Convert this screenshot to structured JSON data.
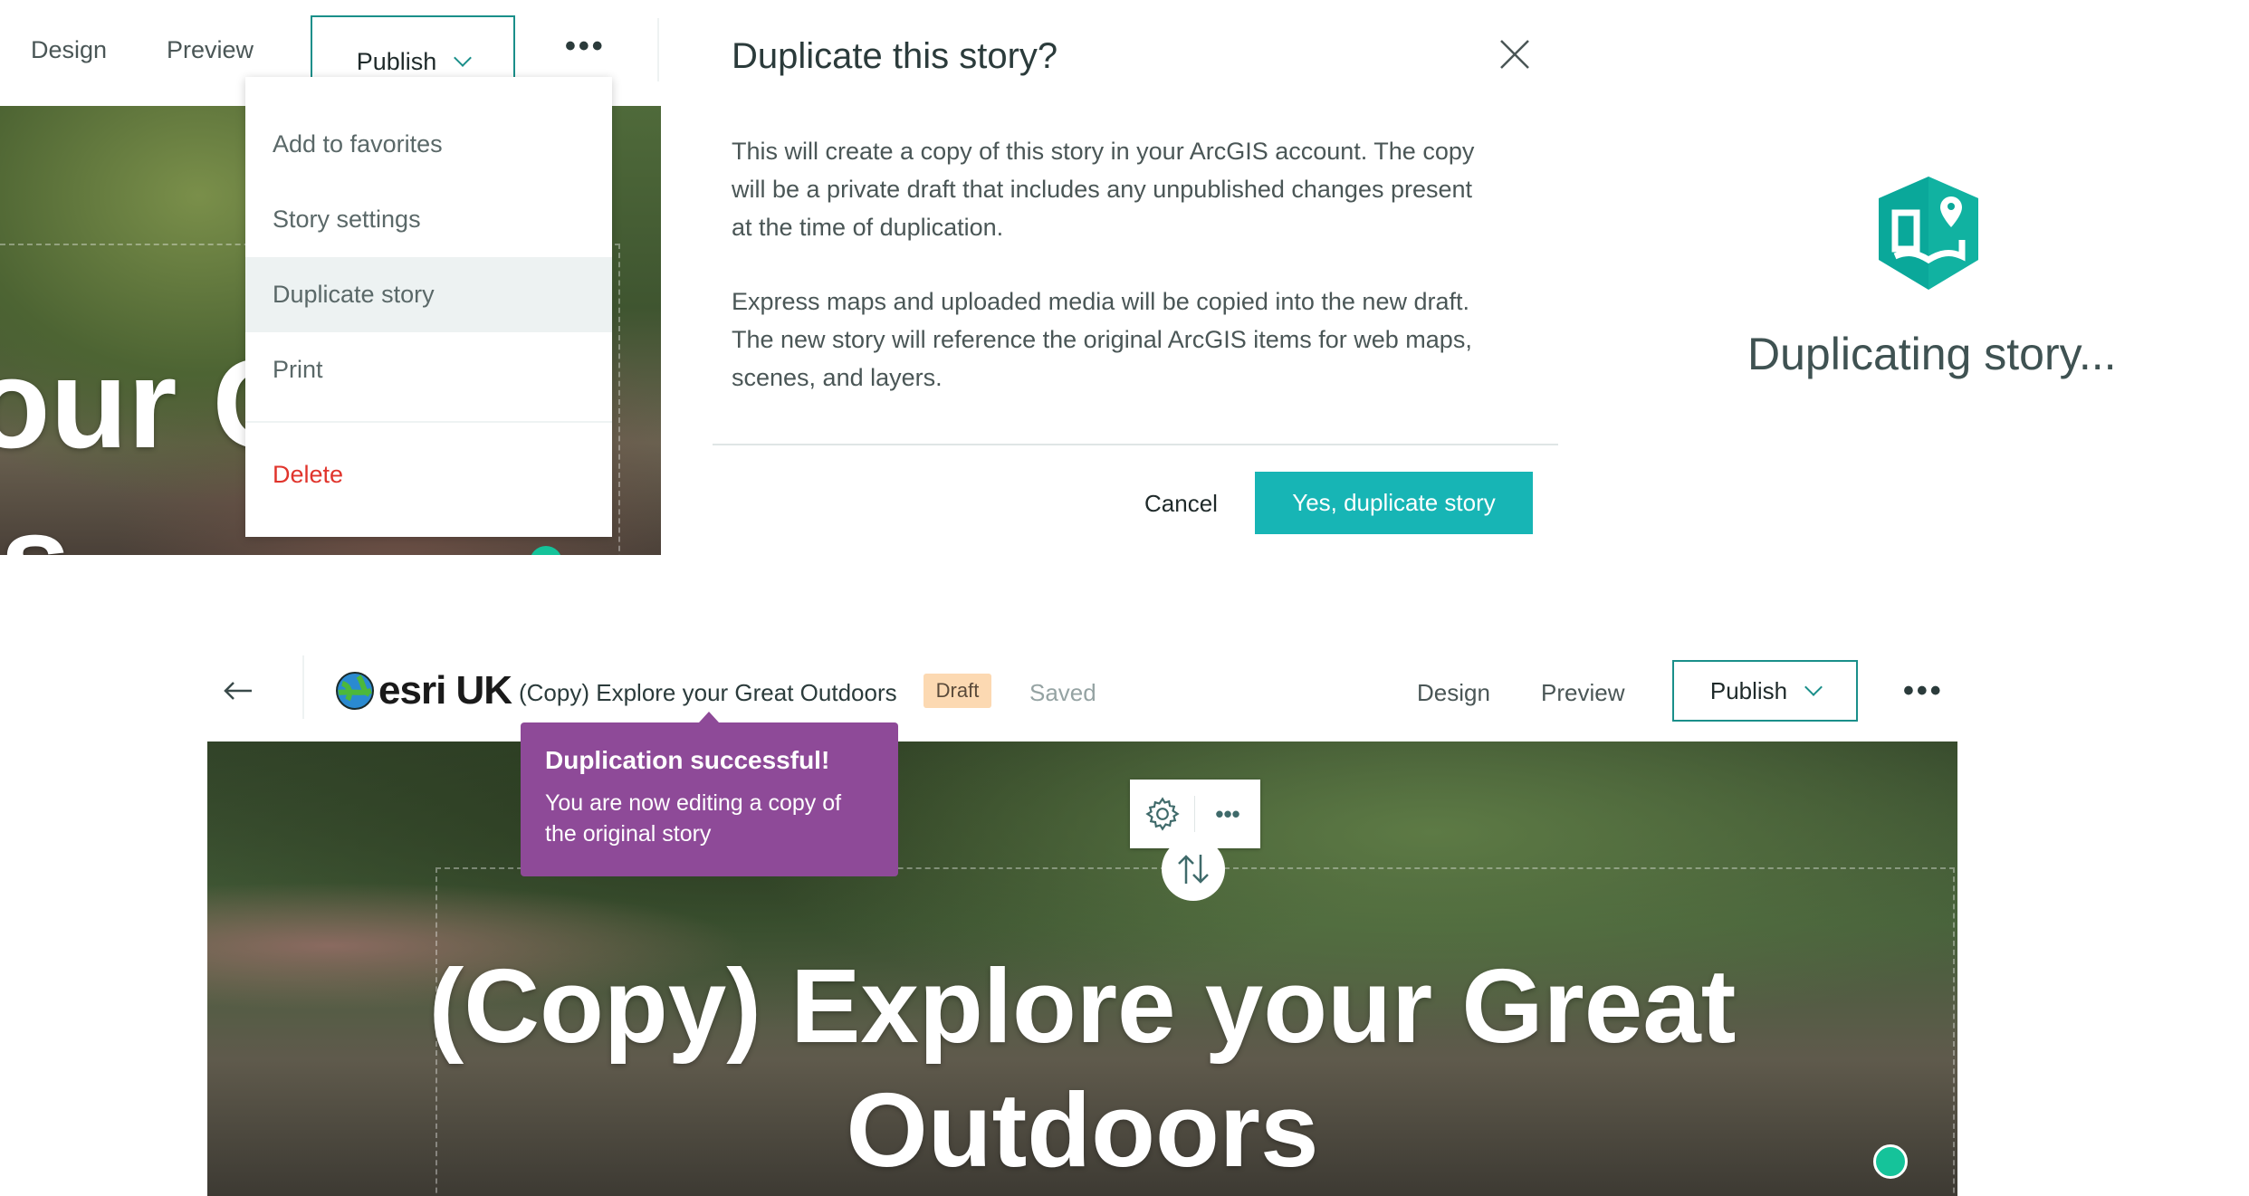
{
  "top_left": {
    "nav": {
      "design": "Design",
      "preview": "Preview",
      "publish": "Publish",
      "more": "•••"
    },
    "menu": {
      "items": [
        {
          "label": "Add to favorites"
        },
        {
          "label": "Story settings"
        },
        {
          "label": "Duplicate story",
          "highlighted": true
        },
        {
          "label": "Print"
        }
      ],
      "delete": "Delete"
    },
    "hero_fragment_1": "our C",
    "hero_fragment_2": "s"
  },
  "dialog": {
    "title": "Duplicate this story?",
    "para1": [
      "This will create a copy of this story in your ArcGIS account. The copy",
      "will be a private draft that includes any unpublished changes present",
      "at the time of duplication."
    ],
    "para2": [
      "Express maps and uploaded media will be copied into the new draft.",
      "The new story will reference the original ArcGIS items for web maps,",
      "scenes, and layers."
    ],
    "cancel": "Cancel",
    "confirm": "Yes, duplicate story",
    "accent": "#17b5b5"
  },
  "loading": {
    "icon": "storymaps-book-pin-icon",
    "text": "Duplicating story..."
  },
  "editor": {
    "back_icon": "arrow-left-icon",
    "logo": "esri UK",
    "story_title": "(Copy) Explore your Great Outdoors",
    "badge": "Draft",
    "status": "Saved",
    "nav": {
      "design": "Design",
      "preview": "Preview",
      "publish": "Publish",
      "more": "•••"
    },
    "toast": {
      "title": "Duplication successful!",
      "body": [
        "You are now editing a copy of",
        "the original story"
      ],
      "color": "#8e4a98"
    },
    "hero_title": [
      "(Copy) Explore your Great",
      "Outdoors"
    ]
  }
}
